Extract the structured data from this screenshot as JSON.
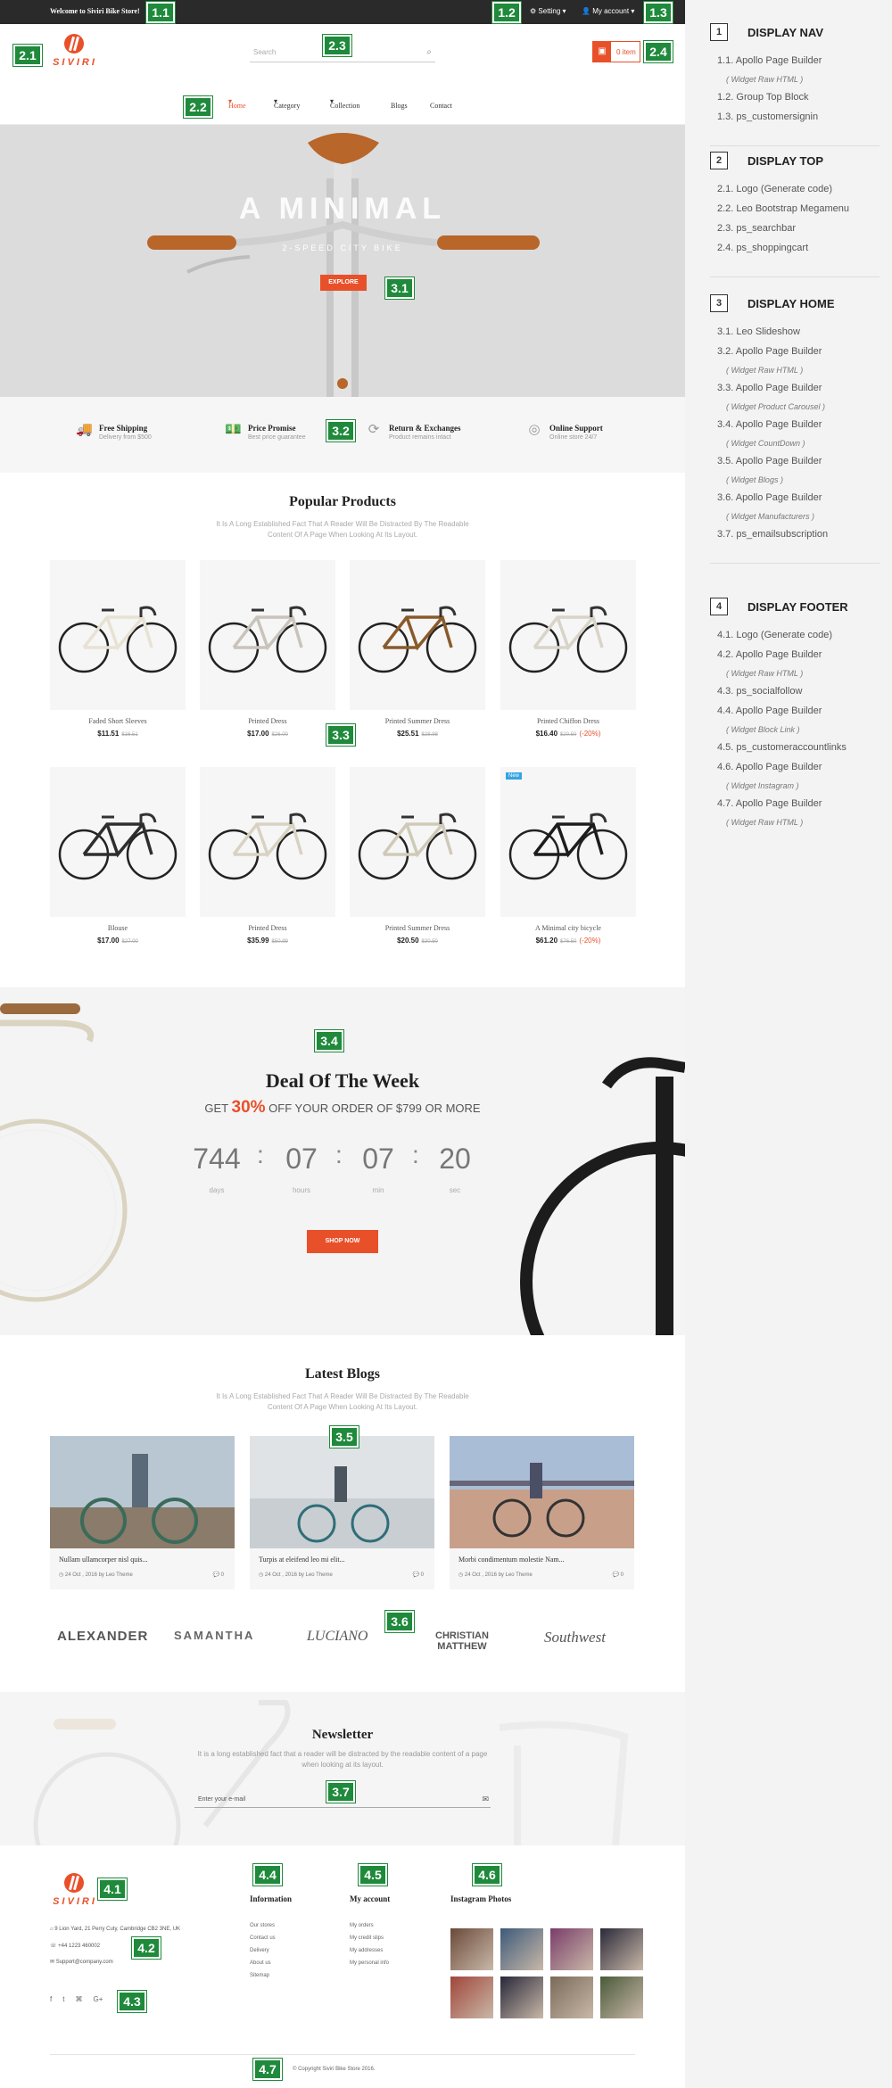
{
  "topbar": {
    "welcome": "Welcome to Siviri Bike Store!",
    "setting": "Setting",
    "account": "My account"
  },
  "logo": {
    "text": "SIVIRI"
  },
  "search": {
    "placeholder": "Search"
  },
  "cart": {
    "label": "0 item"
  },
  "menu": {
    "items": [
      "Home",
      "Category",
      "Collection",
      "Blogs",
      "Contact"
    ]
  },
  "hero": {
    "title": "A MINIMAL",
    "subtitle": "2-SPEED CITY BIKE",
    "button": "EXPLORE"
  },
  "features": [
    {
      "title": "Free Shipping",
      "desc": "Delivery from $500",
      "icon": "truck-icon"
    },
    {
      "title": "Price Promise",
      "desc": "Best price guarantee",
      "icon": "money-icon"
    },
    {
      "title": "Return & Exchanges",
      "desc": "Product remains intact",
      "icon": "refresh-icon"
    },
    {
      "title": "Online Support",
      "desc": "Online store 24/7",
      "icon": "lifebuoy-icon"
    }
  ],
  "popular": {
    "title": "Popular Products",
    "desc": "It Is A Long Established Fact That A Reader Will Be Distracted By The Readable Content Of A Page When Looking At Its Layout.",
    "products": [
      {
        "name": "Faded Short Sleeves",
        "price": "$11.51",
        "old": "$16.51",
        "discount": ""
      },
      {
        "name": "Printed Dress",
        "price": "$17.00",
        "old": "$26.00",
        "discount": ""
      },
      {
        "name": "Printed Summer Dress",
        "price": "$25.51",
        "old": "$28.98",
        "discount": ""
      },
      {
        "name": "Printed Chiffon Dress",
        "price": "$16.40",
        "old": "$20.50",
        "discount": "-20%"
      },
      {
        "name": "Blouse",
        "price": "$17.00",
        "old": "$27.00",
        "discount": ""
      },
      {
        "name": "Printed Dress",
        "price": "$35.99",
        "old": "$50.99",
        "discount": ""
      },
      {
        "name": "Printed Summer Dress",
        "price": "$20.50",
        "old": "$30.50",
        "discount": ""
      },
      {
        "name": "A Minimal city bicycle",
        "price": "$61.20",
        "old": "$76.50",
        "discount": "-20%",
        "badge": "New"
      }
    ]
  },
  "deal": {
    "title": "Deal Of The Week",
    "pre": "GET",
    "pct": "30%",
    "post": "OFF YOUR ORDER OF $799 OR MORE",
    "counter": [
      {
        "v": "744",
        "l": "days"
      },
      {
        "v": "07",
        "l": "hours"
      },
      {
        "v": "07",
        "l": "min"
      },
      {
        "v": "20",
        "l": "sec"
      }
    ],
    "button": "SHOP NOW"
  },
  "blogs": {
    "title": "Latest Blogs",
    "desc": "It Is A Long Established Fact That A Reader Will Be Distracted By The Readable Content Of A Page When Looking At Its Layout.",
    "posts": [
      {
        "title": "Nullam ullamcorper nisl quis...",
        "meta": "24 Oct , 2016 by Leo Theme",
        "comments": "0"
      },
      {
        "title": "Turpis at eleifend leo mi elit...",
        "meta": "24 Oct , 2016 by Leo Theme",
        "comments": "0"
      },
      {
        "title": "Morbi condimentum molestie Nam...",
        "meta": "24 Oct , 2016 by Leo Theme",
        "comments": "0"
      }
    ]
  },
  "brands": [
    "ALEXANDER",
    "SAMANTHA",
    "LUCIANO",
    "CHRISTIAN MATTHEW",
    "Southwest"
  ],
  "newsletter": {
    "title": "Newsletter",
    "desc": "It is a long established fact that a reader will be distracted by the readable content of a page when looking at its layout.",
    "placeholder": "Enter your e-mail"
  },
  "footer": {
    "address": "9 Lion Yard, 21 Perry Cuty, Cambridge CB2 3NE, UK",
    "phone": "+44 1223 460002",
    "email": "Support@company.com",
    "info": {
      "title": "Information",
      "links": [
        "Our stores",
        "Contact us",
        "Delivery",
        "About us",
        "Sitemap"
      ]
    },
    "account": {
      "title": "My account",
      "links": [
        "My orders",
        "My credit slips",
        "My addresses",
        "My personal info"
      ]
    },
    "instagram": {
      "title": "Instagram Photos"
    },
    "copyright": "© Copyright Siviri Bike Store 2016."
  },
  "badges": [
    "1.1",
    "1.2",
    "1.3",
    "2.1",
    "2.2",
    "2.3",
    "2.4",
    "3.1",
    "3.2",
    "3.3",
    "3.4",
    "3.5",
    "3.6",
    "3.7",
    "4.1",
    "4.2",
    "4.3",
    "4.4",
    "4.5",
    "4.6",
    "4.7"
  ],
  "legend": [
    {
      "num": "1",
      "title": "DISPLAY NAV",
      "items": [
        [
          "1.1. Apollo Page Builder",
          0
        ],
        [
          "( Widget Raw HTML )",
          1
        ],
        [
          "1.2. Group Top Block",
          0
        ],
        [
          "1.3. ps_customersignin",
          0
        ]
      ]
    },
    {
      "num": "2",
      "title": "DISPLAY TOP",
      "items": [
        [
          "2.1. Logo (Generate code)",
          0
        ],
        [
          "2.2. Leo Bootstrap Megamenu",
          0
        ],
        [
          "2.3. ps_searchbar",
          0
        ],
        [
          "2.4. ps_shoppingcart",
          0
        ]
      ]
    },
    {
      "num": "3",
      "title": "DISPLAY HOME",
      "items": [
        [
          "3.1. Leo Slideshow",
          0
        ],
        [
          "3.2. Apollo Page Builder",
          0
        ],
        [
          "( Widget Raw HTML )",
          1
        ],
        [
          "3.3. Apollo Page Builder",
          0
        ],
        [
          "( Widget Product Carousel )",
          1
        ],
        [
          "3.4. Apollo Page Builder",
          0
        ],
        [
          "( Widget CountDown )",
          1
        ],
        [
          "3.5. Apollo Page Builder",
          0
        ],
        [
          "( Widget Blogs )",
          1
        ],
        [
          "3.6. Apollo Page Builder",
          0
        ],
        [
          "( Widget Manufacturers )",
          1
        ],
        [
          "3.7. ps_emailsubscription",
          0
        ]
      ]
    },
    {
      "num": "4",
      "title": "DISPLAY FOOTER",
      "items": [
        [
          "4.1. Logo (Generate code)",
          0
        ],
        [
          "4.2. Apollo Page Builder",
          0
        ],
        [
          "( Widget Raw HTML )",
          1
        ],
        [
          "4.3. ps_socialfollow",
          0
        ],
        [
          "4.4. Apollo Page Builder",
          0
        ],
        [
          "( Widget Block Link )",
          1
        ],
        [
          "4.5. ps_customeraccountlinks",
          0
        ],
        [
          "4.6. Apollo Page Builder",
          0
        ],
        [
          "( Widget Instagram )",
          1
        ],
        [
          "4.7. Apollo Page Builder",
          0
        ],
        [
          "( Widget Raw HTML )",
          1
        ]
      ]
    }
  ],
  "colors": {
    "accent": "#e8502a",
    "badge": "#1f8a3b"
  }
}
